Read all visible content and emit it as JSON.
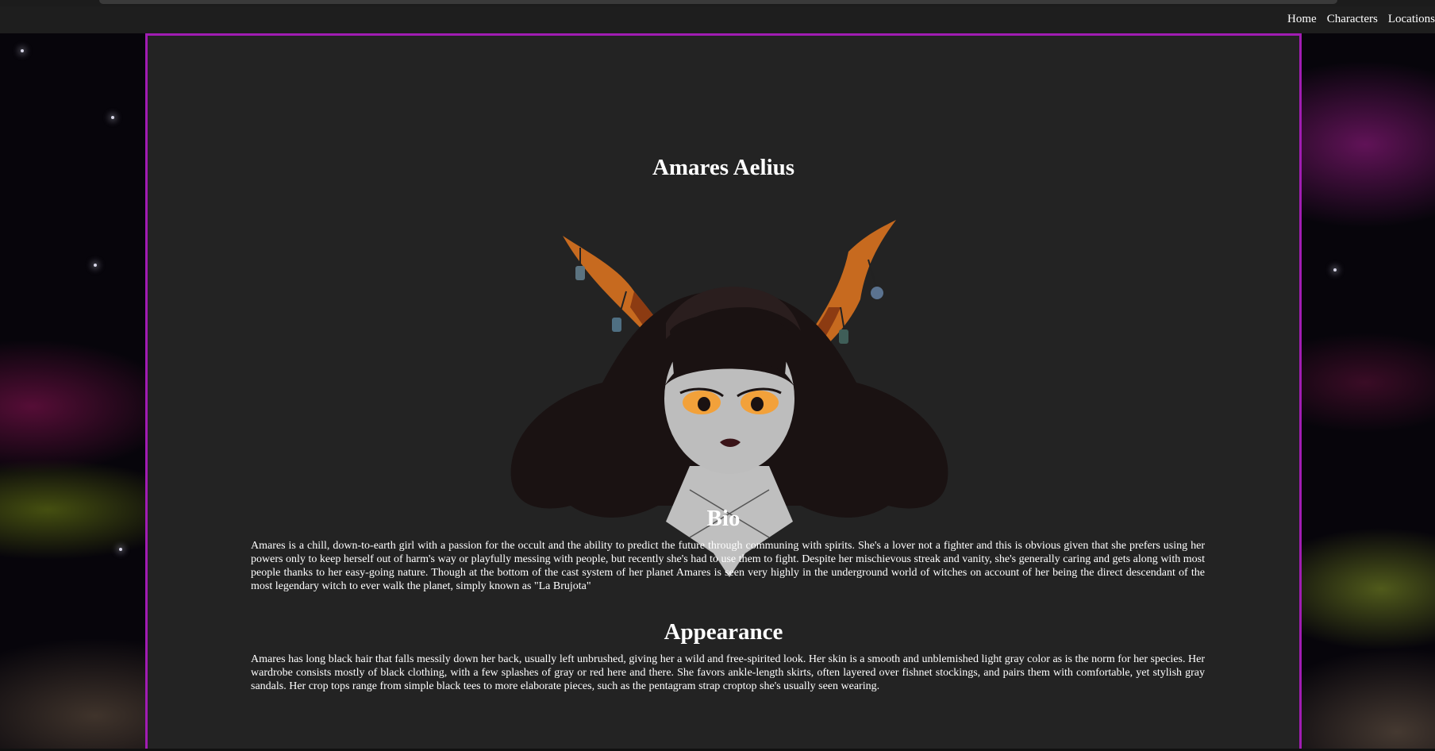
{
  "nav": {
    "links": [
      "Home",
      "Characters",
      "Locations"
    ]
  },
  "character": {
    "name": "Amares Aelius",
    "portrait_icon": "character-portrait-horned-girl"
  },
  "sections": {
    "bio": {
      "heading": "Bio",
      "text": "Amares is a chill, down-to-earth girl with a passion for the occult and the ability to predict the future through communing with spirits. She's a lover not a fighter and this is obvious given that she prefers using her powers only to keep herself out of harm's way or playfully messing with people, but recently she's had to use them to fight. Despite her mischievous streak and vanity, she's generally caring and gets along with most people thanks to her easy-going nature. Though at the bottom of the cast system of her planet Amares is seen very highly in the underground world of witches on account of her being the direct descendant of the most legendary witch to ever walk the planet, simply known as \"La Brujota\""
    },
    "appearance": {
      "heading": "Appearance",
      "text": "Amares has long black hair that falls messily down her back, usually left unbrushed, giving her a wild and free-spirited look. Her skin is a smooth and unblemished light gray color as is the norm for her species. Her wardrobe consists mostly of black clothing, with a few splashes of gray or red here and there. She favors ankle-length skirts, often layered over fishnet stockings, and pairs them with comfortable, yet stylish gray sandals. Her crop tops range from simple black tees to more elaborate pieces, such as the pentagram strap croptop she's usually seen wearing."
    }
  },
  "colors": {
    "panel_bg": "#232323",
    "panel_border": "#a11cb3",
    "nav_bg": "#1e1e1e",
    "text": "#ffffff"
  }
}
